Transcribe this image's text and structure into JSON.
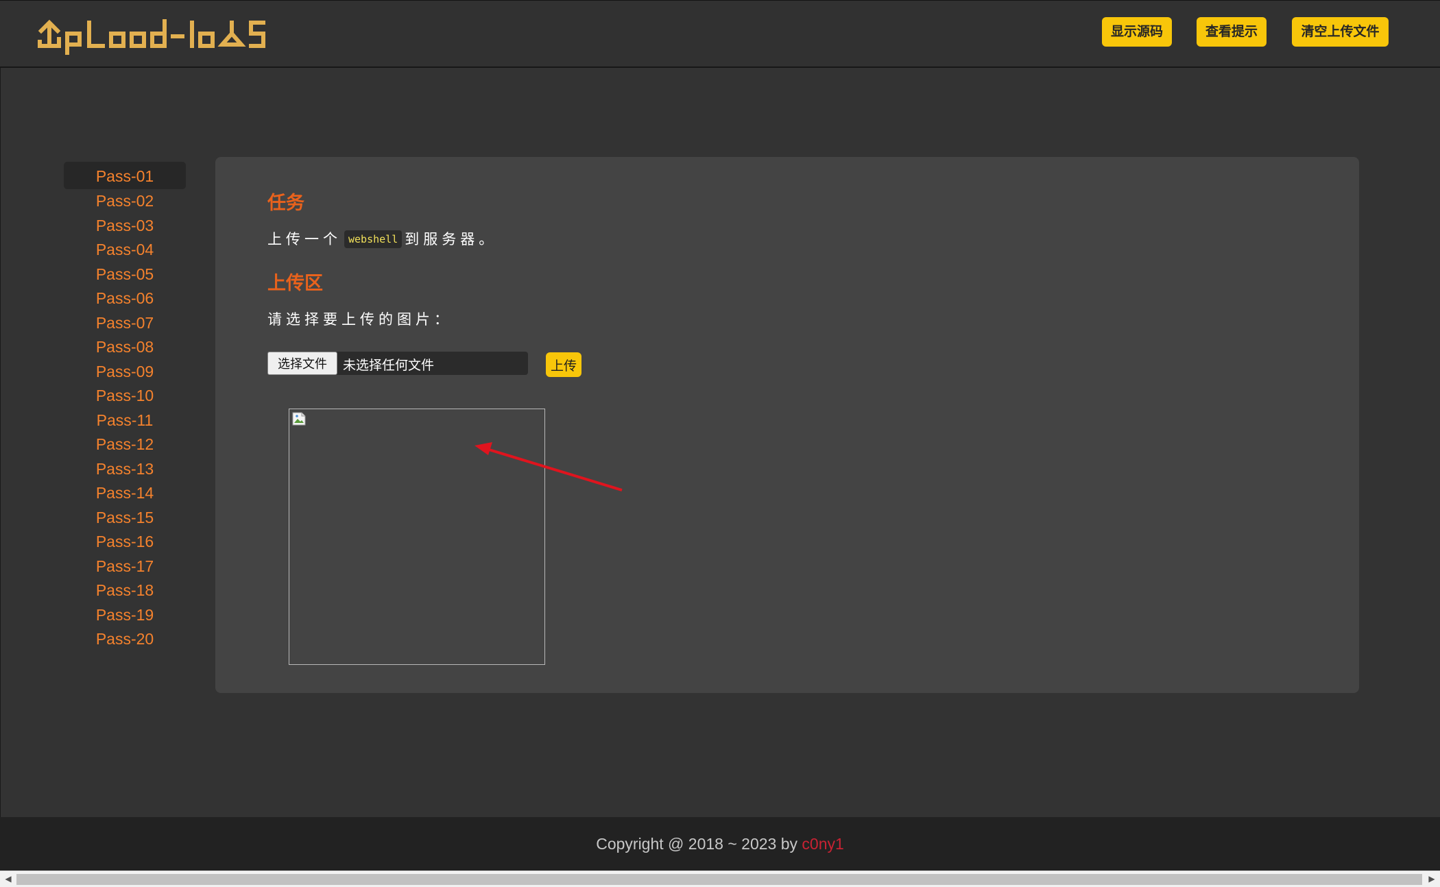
{
  "header": {
    "logo_text": "UpLoad-labS",
    "buttons": {
      "show_source": "显示源码",
      "view_hint": "查看提示",
      "clear_uploads": "清空上传文件"
    }
  },
  "sidebar": {
    "items": [
      {
        "label": "Pass-01",
        "active": true
      },
      {
        "label": "Pass-02"
      },
      {
        "label": "Pass-03"
      },
      {
        "label": "Pass-04"
      },
      {
        "label": "Pass-05"
      },
      {
        "label": "Pass-06"
      },
      {
        "label": "Pass-07"
      },
      {
        "label": "Pass-08"
      },
      {
        "label": "Pass-09"
      },
      {
        "label": "Pass-10"
      },
      {
        "label": "Pass-11"
      },
      {
        "label": "Pass-12"
      },
      {
        "label": "Pass-13"
      },
      {
        "label": "Pass-14"
      },
      {
        "label": "Pass-15"
      },
      {
        "label": "Pass-16"
      },
      {
        "label": "Pass-17"
      },
      {
        "label": "Pass-18"
      },
      {
        "label": "Pass-19"
      },
      {
        "label": "Pass-20"
      }
    ]
  },
  "task": {
    "title": "任务",
    "desc_before": "上传一个",
    "desc_code": "webshell",
    "desc_after": "到服务器。"
  },
  "upload": {
    "title": "上传区",
    "prompt": "请选择要上传的图片：",
    "choose_file_label": "选择文件",
    "no_file_text": "未选择任何文件",
    "submit_label": "上传",
    "preview_icon": "broken-image-icon"
  },
  "footer": {
    "text": "Copyright @ 2018 ~ 2023 by ",
    "author": "c0ny1"
  },
  "colors": {
    "accent_yellow": "#f8c60a",
    "link_orange": "#f5822d",
    "heading_orange": "#e9621c",
    "author_red": "#c92233",
    "annotation_arrow": "#e0141e"
  }
}
